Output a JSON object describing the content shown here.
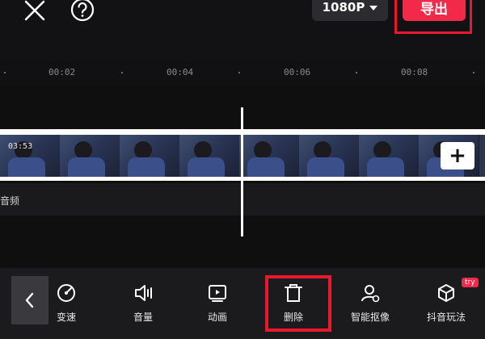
{
  "header": {
    "resolution_label": "1080P",
    "export_label": "导出"
  },
  "ruler": {
    "ticks": [
      "00:02",
      "00:04",
      "00:06",
      "00:08"
    ]
  },
  "timeline": {
    "clip_duration": "03:53",
    "audio_label": "音频"
  },
  "toolbar": {
    "items": [
      {
        "label": "变速",
        "icon": "speed-icon"
      },
      {
        "label": "音量",
        "icon": "volume-icon"
      },
      {
        "label": "动画",
        "icon": "animation-icon"
      },
      {
        "label": "删除",
        "icon": "delete-icon"
      },
      {
        "label": "智能抠像",
        "icon": "smart-cutout-icon"
      },
      {
        "label": "抖音玩法",
        "icon": "douyin-effects-icon"
      }
    ],
    "try_badge": "try"
  },
  "colors": {
    "accent": "#f3294a",
    "highlight": "#e8192c",
    "background": "#0f0f10"
  }
}
